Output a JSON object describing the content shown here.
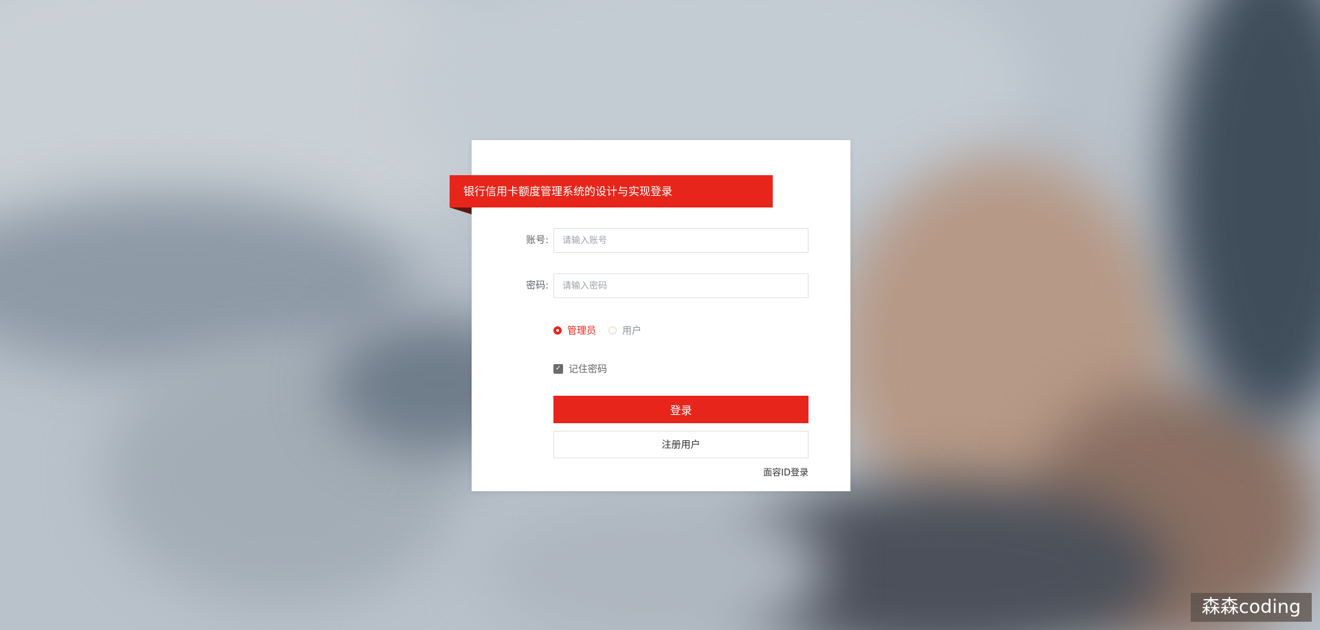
{
  "login": {
    "title": "银行信用卡额度管理系统的设计与实现登录",
    "account_label": "账号:",
    "account_placeholder": "请输入账号",
    "password_label": "密码:",
    "password_placeholder": "请输入密码",
    "roles": [
      {
        "label": "管理员",
        "selected": true
      },
      {
        "label": "用户",
        "selected": false
      }
    ],
    "remember_label": "记住密码",
    "remember_checked": true,
    "login_button": "登录",
    "register_button": "注册用户",
    "faceid_link": "面容ID登录"
  },
  "watermark": "森森coding",
  "colors": {
    "accent": "#e8251a",
    "background": "#b9c2cb"
  }
}
